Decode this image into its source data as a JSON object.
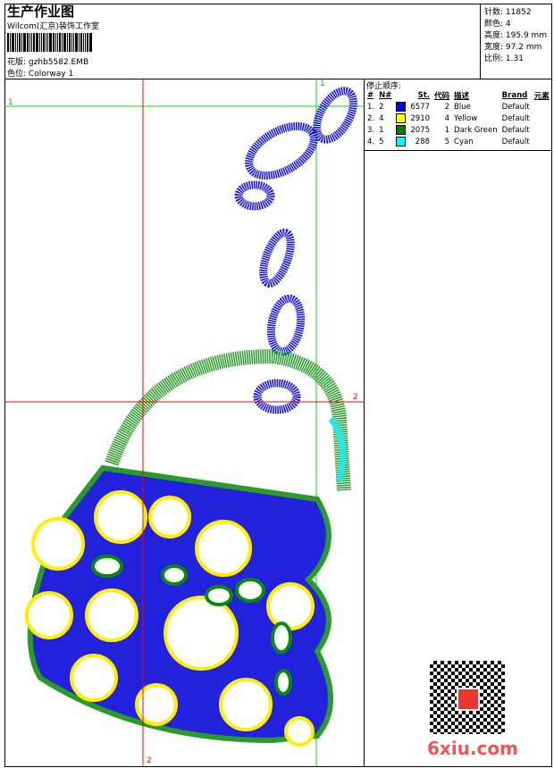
{
  "header": {
    "title": "生产作业图",
    "company": "Wilcom(汇京)装饰工作室",
    "design_label": "花版:",
    "design_value": "gzhb5582.EMB",
    "colorway_label": "色位:",
    "colorway_value": "Colorway 1"
  },
  "stats": [
    {
      "label": "针数:",
      "value": "11852"
    },
    {
      "label": "颜色:",
      "value": "4"
    },
    {
      "label": "高度:",
      "value": "195.9 mm"
    },
    {
      "label": "宽度:",
      "value": "97.2 mm"
    },
    {
      "label": "比例:",
      "value": "1.31"
    }
  ],
  "stop_sequence": {
    "title": "停止顺序:",
    "columns": [
      "#",
      "N#",
      "St.",
      "代码",
      "描述",
      "Brand",
      "元素"
    ],
    "rows": [
      {
        "idx": "1.",
        "n": "2",
        "color": "#0000ff",
        "st": "6577",
        "code": "2",
        "desc": "Blue",
        "brand": "Default"
      },
      {
        "idx": "2.",
        "n": "4",
        "color": "#ffff00",
        "st": "2910",
        "code": "4",
        "desc": "Yellow",
        "brand": "Default"
      },
      {
        "idx": "3.",
        "n": "1",
        "color": "#008000",
        "st": "2075",
        "code": "1",
        "desc": "Dark Green",
        "brand": "Default"
      },
      {
        "idx": "4.",
        "n": "5",
        "color": "#00ffff",
        "st": "288",
        "code": "5",
        "desc": "Cyan",
        "brand": "Default"
      }
    ]
  },
  "guides": {
    "green_label_1": "1",
    "green_label_1b": "1",
    "red_label_2": "2",
    "red_label_2b": "2"
  },
  "watermark": "6xiu.com"
}
